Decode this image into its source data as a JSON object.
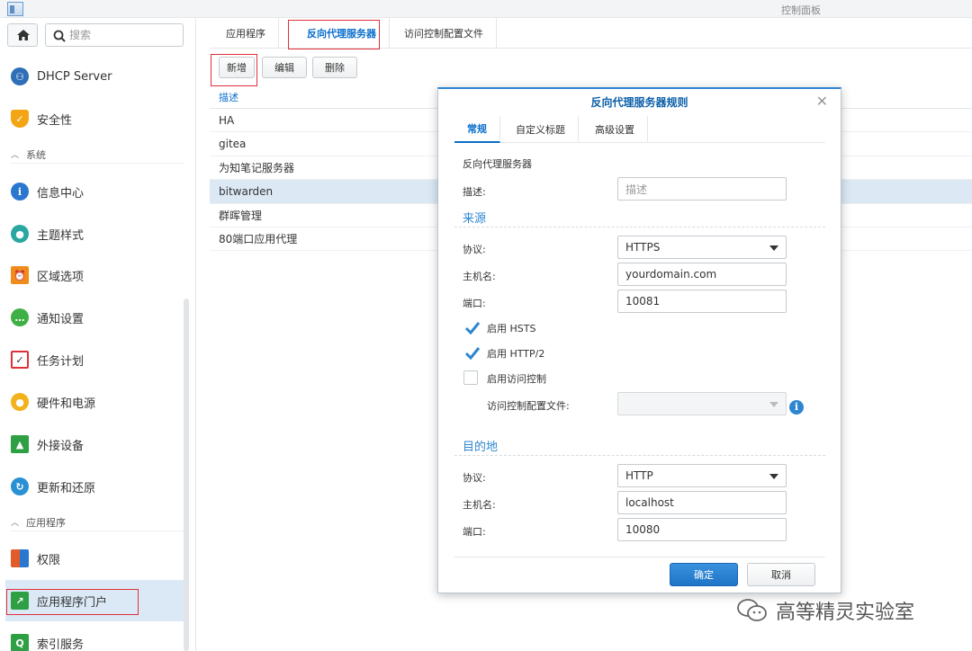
{
  "window": {
    "title": "控制面板"
  },
  "search": {
    "placeholder": "搜索"
  },
  "sidebar": {
    "items": [
      {
        "label": "DHCP Server",
        "icon": "dhcp-icon",
        "color": "#2e6fb7"
      },
      {
        "label": "安全性",
        "icon": "shield-icon",
        "color": "#f3a516"
      },
      {
        "label": "信息中心",
        "icon": "info-icon",
        "color": "#2a77cf"
      },
      {
        "label": "主题样式",
        "icon": "palette-icon",
        "color": "#2aa7a0"
      },
      {
        "label": "区域选项",
        "icon": "regional-icon",
        "color": "#f08c1a"
      },
      {
        "label": "通知设置",
        "icon": "chat-icon",
        "color": "#3fb045"
      },
      {
        "label": "任务计划",
        "icon": "calendar-check-icon",
        "color": "#e0303a"
      },
      {
        "label": "硬件和电源",
        "icon": "bulb-icon",
        "color": "#f3b21c"
      },
      {
        "label": "外接设备",
        "icon": "external-device-icon",
        "color": "#2ea043"
      },
      {
        "label": "更新和还原",
        "icon": "refresh-icon",
        "color": "#2a90d4"
      },
      {
        "label": "权限",
        "icon": "permission-icon",
        "color": "#e25b2a"
      },
      {
        "label": "应用程序门户",
        "icon": "app-portal-icon",
        "color": "#2ea043"
      },
      {
        "label": "索引服务",
        "icon": "index-icon",
        "color": "#2ea043"
      }
    ],
    "sections": {
      "system": "系统",
      "apps": "应用程序"
    }
  },
  "tabs": [
    "应用程序",
    "反向代理服务器",
    "访问控制配置文件"
  ],
  "toolbar": {
    "add": "新增",
    "edit": "编辑",
    "delete": "删除"
  },
  "grid": {
    "header": "描述",
    "rows": [
      "HA",
      "gitea",
      "为知笔记服务器",
      "bitwarden",
      "群晖管理",
      "80端口应用代理"
    ]
  },
  "dialog": {
    "title": "反向代理服务器规则",
    "tabs": [
      "常规",
      "自定义标题",
      "高级设置"
    ],
    "group_label": "反向代理服务器",
    "description_label": "描述:",
    "description_placeholder": "描述",
    "source": {
      "heading": "来源",
      "protocol_label": "协议:",
      "protocol": "HTTPS",
      "hostname_label": "主机名:",
      "hostname": "yourdomain.com",
      "port_label": "端口:",
      "port": "10081",
      "hsts_label": "启用 HSTS",
      "hsts": true,
      "http2_label": "启用 HTTP/2",
      "http2": true,
      "access_control_label": "启用访问控制",
      "access_control": false,
      "access_profile_label": "访问控制配置文件:"
    },
    "destination": {
      "heading": "目的地",
      "protocol_label": "协议:",
      "protocol": "HTTP",
      "hostname_label": "主机名:",
      "hostname": "localhost",
      "port_label": "端口:",
      "port": "10080"
    },
    "ok": "确定",
    "cancel": "取消"
  },
  "watermark": "高等精灵实验室"
}
